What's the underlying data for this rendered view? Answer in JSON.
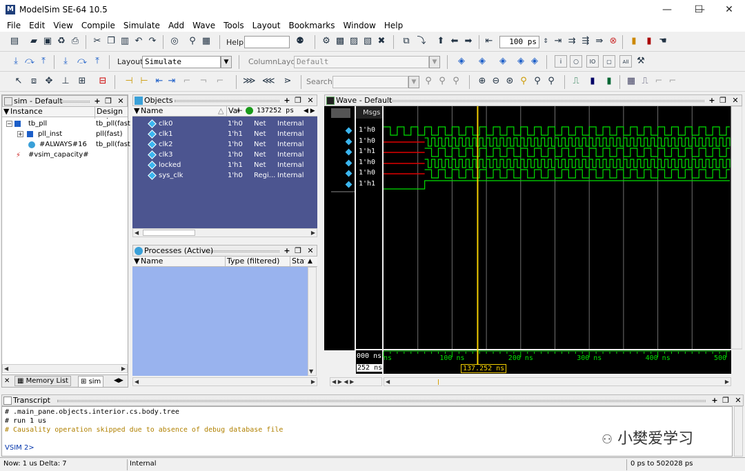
{
  "app": {
    "title": "ModelSim SE-64 10.5",
    "logo": "M",
    "window_controls": [
      "—",
      "☐",
      "✕"
    ]
  },
  "menu": [
    "File",
    "Edit",
    "View",
    "Compile",
    "Simulate",
    "Add",
    "Wave",
    "Tools",
    "Layout",
    "Bookmarks",
    "Window",
    "Help"
  ],
  "toolbar": {
    "help_label": "Help",
    "run_length": "100 ps",
    "layout_label": "Layout",
    "layout_value": "Simulate",
    "column_layout_label": "ColumnLayout",
    "column_layout_value": "Default",
    "search_label": "Search:"
  },
  "sim_pane": {
    "title": "sim - Default",
    "col_instance": "Instance",
    "col_design": "Design uni",
    "rows": [
      {
        "name": "tb_pll",
        "design": "tb_pll(fast"
      },
      {
        "name": "pll_inst",
        "design": "pll(fast)"
      },
      {
        "name": "#ALWAYS#16",
        "design": "tb_pll(fast"
      },
      {
        "name": "#vsim_capacity#",
        "design": ""
      }
    ],
    "tabs": [
      "Memory List",
      "sim"
    ]
  },
  "objects_pane": {
    "title": "Objects",
    "col_name": "Name",
    "col_value": "Val",
    "time": "137252 ps",
    "rows": [
      {
        "name": "clk0",
        "value": "1'h0",
        "kind": "Net",
        "mode": "Internal"
      },
      {
        "name": "clk1",
        "value": "1'h1",
        "kind": "Net",
        "mode": "Internal"
      },
      {
        "name": "clk2",
        "value": "1'h0",
        "kind": "Net",
        "mode": "Internal"
      },
      {
        "name": "clk3",
        "value": "1'h0",
        "kind": "Net",
        "mode": "Internal"
      },
      {
        "name": "locked",
        "value": "1'h1",
        "kind": "Net",
        "mode": "Internal"
      },
      {
        "name": "sys_clk",
        "value": "1'h0",
        "kind": "Regi...",
        "mode": "Internal"
      }
    ]
  },
  "processes_pane": {
    "title": "Processes (Active)",
    "col_name": "Name",
    "col_type": "Type (filtered)",
    "col_state": "State"
  },
  "wave_pane": {
    "title": "Wave - Default",
    "msgs_label": "Msgs",
    "values": [
      "1'h0",
      "1'h0",
      "1'h1",
      "1'h0",
      "1'h0",
      "1'h1"
    ],
    "now_label": "000 ns",
    "cursor_label": "252 ns",
    "ticks": [
      "ns",
      "100 ns",
      "200 ns",
      "300 ns",
      "400 ns",
      "500"
    ],
    "cursor_time": "137.252 ns",
    "colors": {
      "signal": "#00e000",
      "cursor": "#f5d000",
      "undefined": "#e00000",
      "background": "#000000"
    }
  },
  "transcript": {
    "title": "Transcript",
    "lines": [
      "# .main_pane.objects.interior.cs.body.tree",
      "# run 1 us",
      "# Causality operation skipped due to absence of debug database file"
    ],
    "prompt": "VSIM 2>",
    "watermark": "小樊爱学习"
  },
  "status": {
    "now": "Now: 1 us  Delta: 7",
    "context": "Internal",
    "range": "0 ps to 502028 ps"
  }
}
